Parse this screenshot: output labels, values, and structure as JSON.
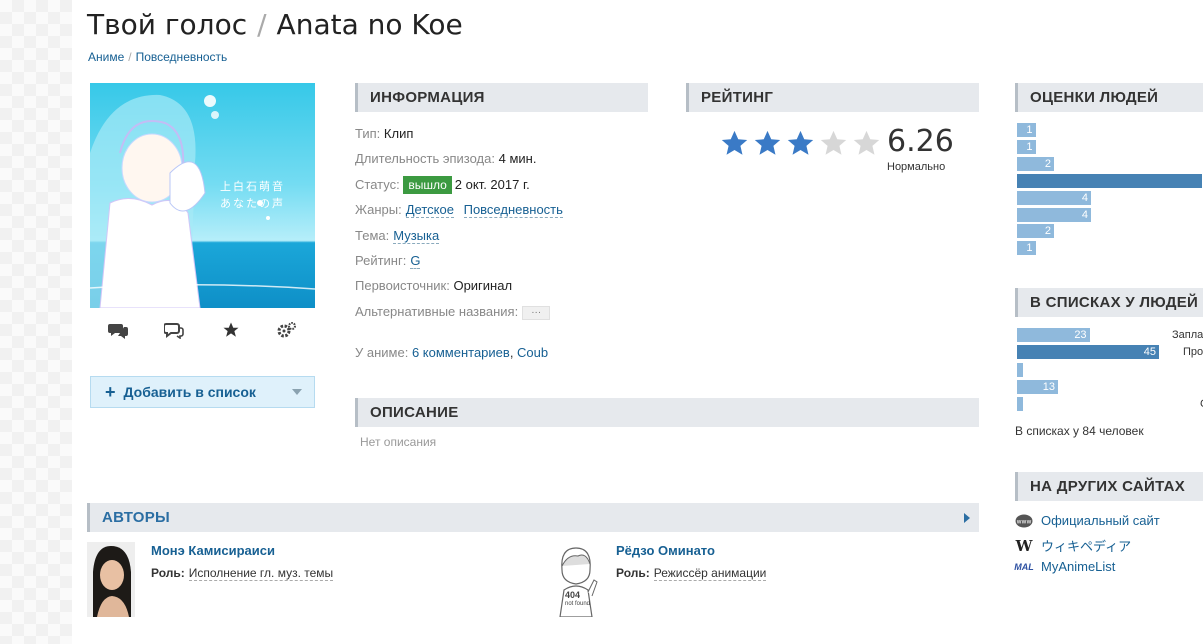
{
  "title": {
    "ru": "Твой голос",
    "separator": "/",
    "romaji": "Anata no Koe"
  },
  "breadcrumbs": [
    "Аниме",
    "Повседневность"
  ],
  "poster": {
    "caption_line1": "上白石萌音",
    "caption_line2": "あなたの声"
  },
  "poster_actions": [
    "comments-icon",
    "discussion-icon",
    "favorite-star-icon",
    "settings-icon"
  ],
  "add_to_list": {
    "label": "Добавить в список"
  },
  "info": {
    "heading": "ИНФОРМАЦИЯ",
    "type_label": "Тип:",
    "type_value": "Клип",
    "duration_label": "Длительность эпизода:",
    "duration_value": "4 мин.",
    "status_label": "Статус:",
    "status_badge": "вышло",
    "status_date": "2 окт. 2017 г.",
    "genres_label": "Жанры:",
    "genres": [
      "Детское",
      "Повседневность"
    ],
    "theme_label": "Тема:",
    "theme_value": "Музыка",
    "rating_label": "Рейтинг:",
    "rating_value": "G",
    "source_label": "Первоисточник:",
    "source_value": "Оригинал",
    "alt_names_label": "Альтернативные названия:",
    "alt_names_button": "···",
    "anime_label": "У аниме:",
    "comments_link": "6 комментариев",
    "coub_link": "Coub"
  },
  "rating": {
    "heading": "РЕЙТИНГ",
    "score": "6.26",
    "word": "Нормально",
    "stars_filled": 3,
    "stars_total": 5
  },
  "description": {
    "heading": "ОПИСАНИЕ",
    "text": "Нет описания"
  },
  "people_scores": {
    "heading": "ОЦЕНКИ ЛЮДЕЙ",
    "bars": [
      {
        "value": "1",
        "count": 1
      },
      {
        "value": "1",
        "count": 1
      },
      {
        "value": "2",
        "count": 2
      },
      {
        "value": "",
        "count": 10
      },
      {
        "value": "4",
        "count": 4
      },
      {
        "value": "4",
        "count": 4
      },
      {
        "value": "2",
        "count": 2
      },
      {
        "value": "1",
        "count": 1
      }
    ]
  },
  "in_lists": {
    "heading": "В СПИСКАХ У ЛЮДЕЙ",
    "bars": [
      {
        "value": "23",
        "count": 23,
        "label": "Запла"
      },
      {
        "value": "45",
        "count": 45,
        "label": "Про"
      },
      {
        "value": "",
        "count": 1,
        "label": ""
      },
      {
        "value": "13",
        "count": 13,
        "label": ""
      },
      {
        "value": "",
        "count": 1,
        "label": "С"
      }
    ],
    "total_text": "В списках у 84 человек"
  },
  "other_sites": {
    "heading": "НА ДРУГИХ САЙТАХ",
    "links": [
      {
        "label": "Официальный сайт",
        "icon": "www-icon"
      },
      {
        "label": "ウィキペディア",
        "icon": "wikipedia-icon"
      },
      {
        "label": "MyAnimeList",
        "icon": "mal-icon"
      }
    ]
  },
  "authors": {
    "heading": "АВТОРЫ",
    "people": [
      {
        "name": "Монэ Камисираиси",
        "role_label": "Роль:",
        "role": "Исполнение гл. муз. темы"
      },
      {
        "name": "Рёдзо Оминато",
        "role_label": "Роль:",
        "role": "Режиссёр анимации",
        "placeholder_text1": "404",
        "placeholder_text2": "not found"
      }
    ]
  },
  "colors": {
    "link": "#176093",
    "status_green": "#3c9a41",
    "star_filled": "#3a7ac6",
    "bar_light": "#8fb9dc",
    "bar_dark": "#4682b4"
  }
}
